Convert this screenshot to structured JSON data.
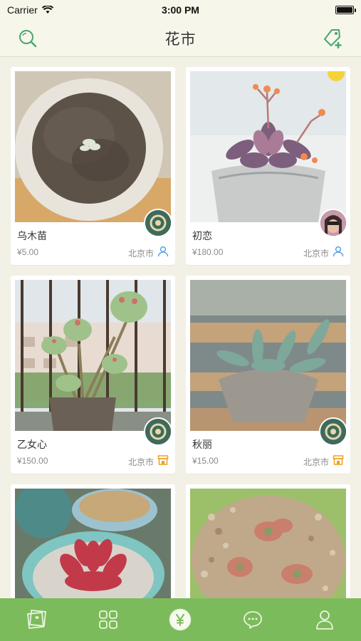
{
  "status": {
    "carrier": "Carrier",
    "time": "3:00 PM"
  },
  "nav": {
    "title": "花市"
  },
  "listings": [
    {
      "name": "乌木苗",
      "price": "¥5.00",
      "location": "北京市",
      "badge": "person-icon"
    },
    {
      "name": "初恋",
      "price": "¥180.00",
      "location": "北京市",
      "badge": "person-icon"
    },
    {
      "name": "乙女心",
      "price": "¥150.00",
      "location": "北京市",
      "badge": "shop-icon"
    },
    {
      "name": "秋丽",
      "price": "¥15.00",
      "location": "北京市",
      "badge": "shop-icon"
    }
  ],
  "tabs": [
    {
      "icon": "gallery-icon"
    },
    {
      "icon": "grid-icon"
    },
    {
      "icon": "yen-icon",
      "active": true
    },
    {
      "icon": "chat-icon"
    },
    {
      "icon": "profile-icon"
    }
  ],
  "colors": {
    "accent": "#7cbb5b",
    "icon_green": "#4aa56e",
    "badge_blue": "#5aa0e6",
    "badge_orange": "#f0a020"
  }
}
